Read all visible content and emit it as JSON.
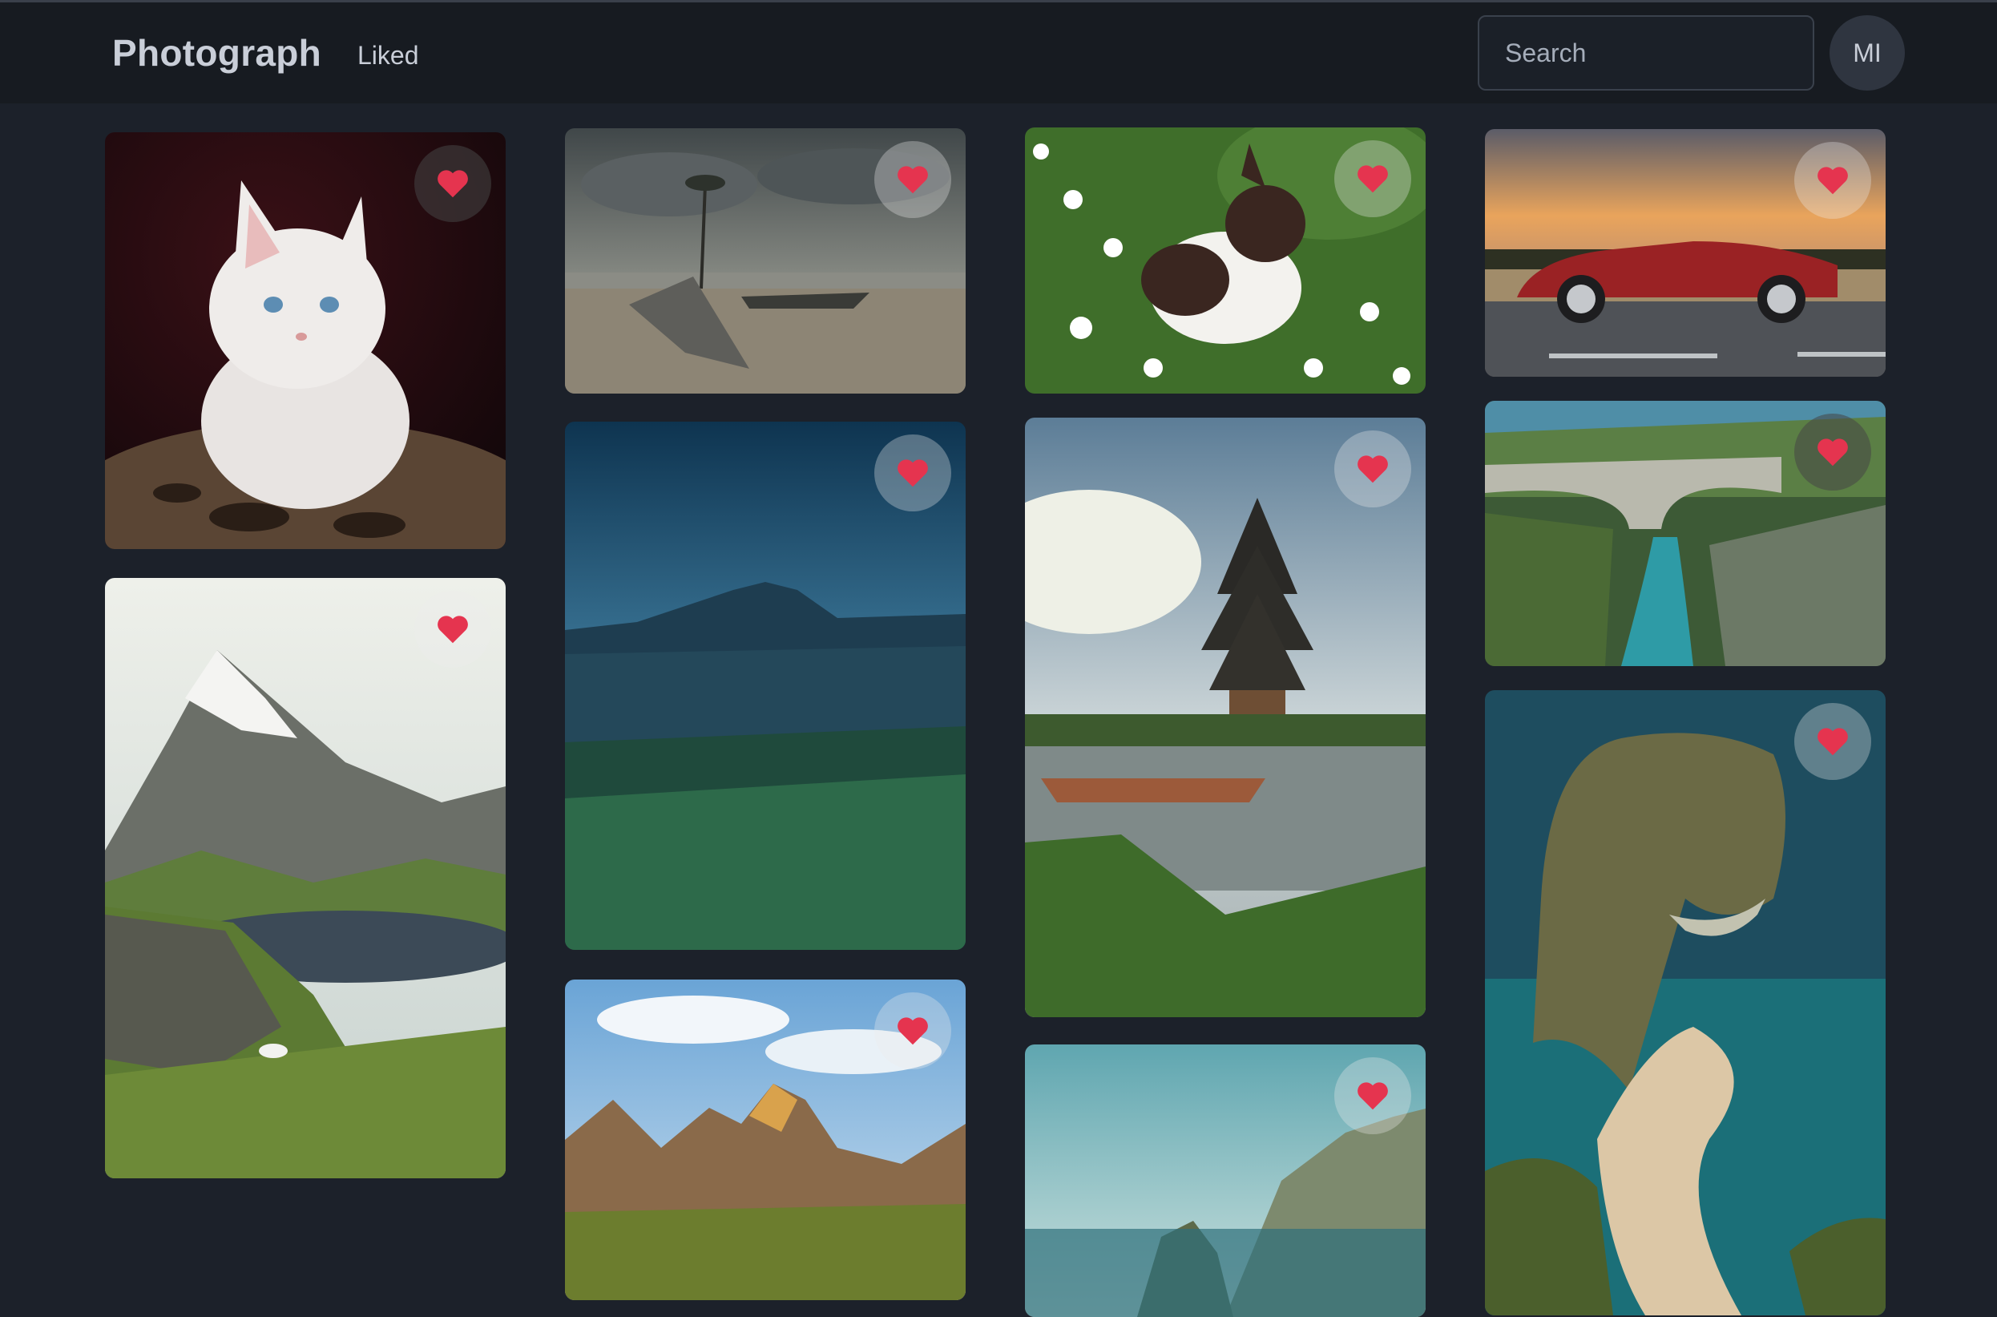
{
  "navbar": {
    "brand": "Photograph",
    "links": [
      "Liked"
    ],
    "search_placeholder": "Search",
    "avatar_initials": "MI"
  },
  "colors": {
    "background": "#1c212a",
    "navbar": "#171b21",
    "heart": "#e5344f",
    "text": "#c9ced8"
  },
  "photos": [
    {
      "subject": "white kitten",
      "liked": true
    },
    {
      "subject": "beach boat palm tree",
      "liked": true
    },
    {
      "subject": "rabbit in daisies",
      "liked": true
    },
    {
      "subject": "red convertible car",
      "liked": true
    },
    {
      "subject": "mountain lake valley",
      "liked": true
    },
    {
      "subject": "night volcano field",
      "liked": true
    },
    {
      "subject": "lake temple pagoda",
      "liked": true
    },
    {
      "subject": "stone bridge gorge",
      "liked": true
    },
    {
      "subject": "canyon autumn trees",
      "liked": true
    },
    {
      "subject": "coastal cliffs sea",
      "liked": true
    },
    {
      "subject": "sea rock beach aerial",
      "liked": true
    }
  ]
}
